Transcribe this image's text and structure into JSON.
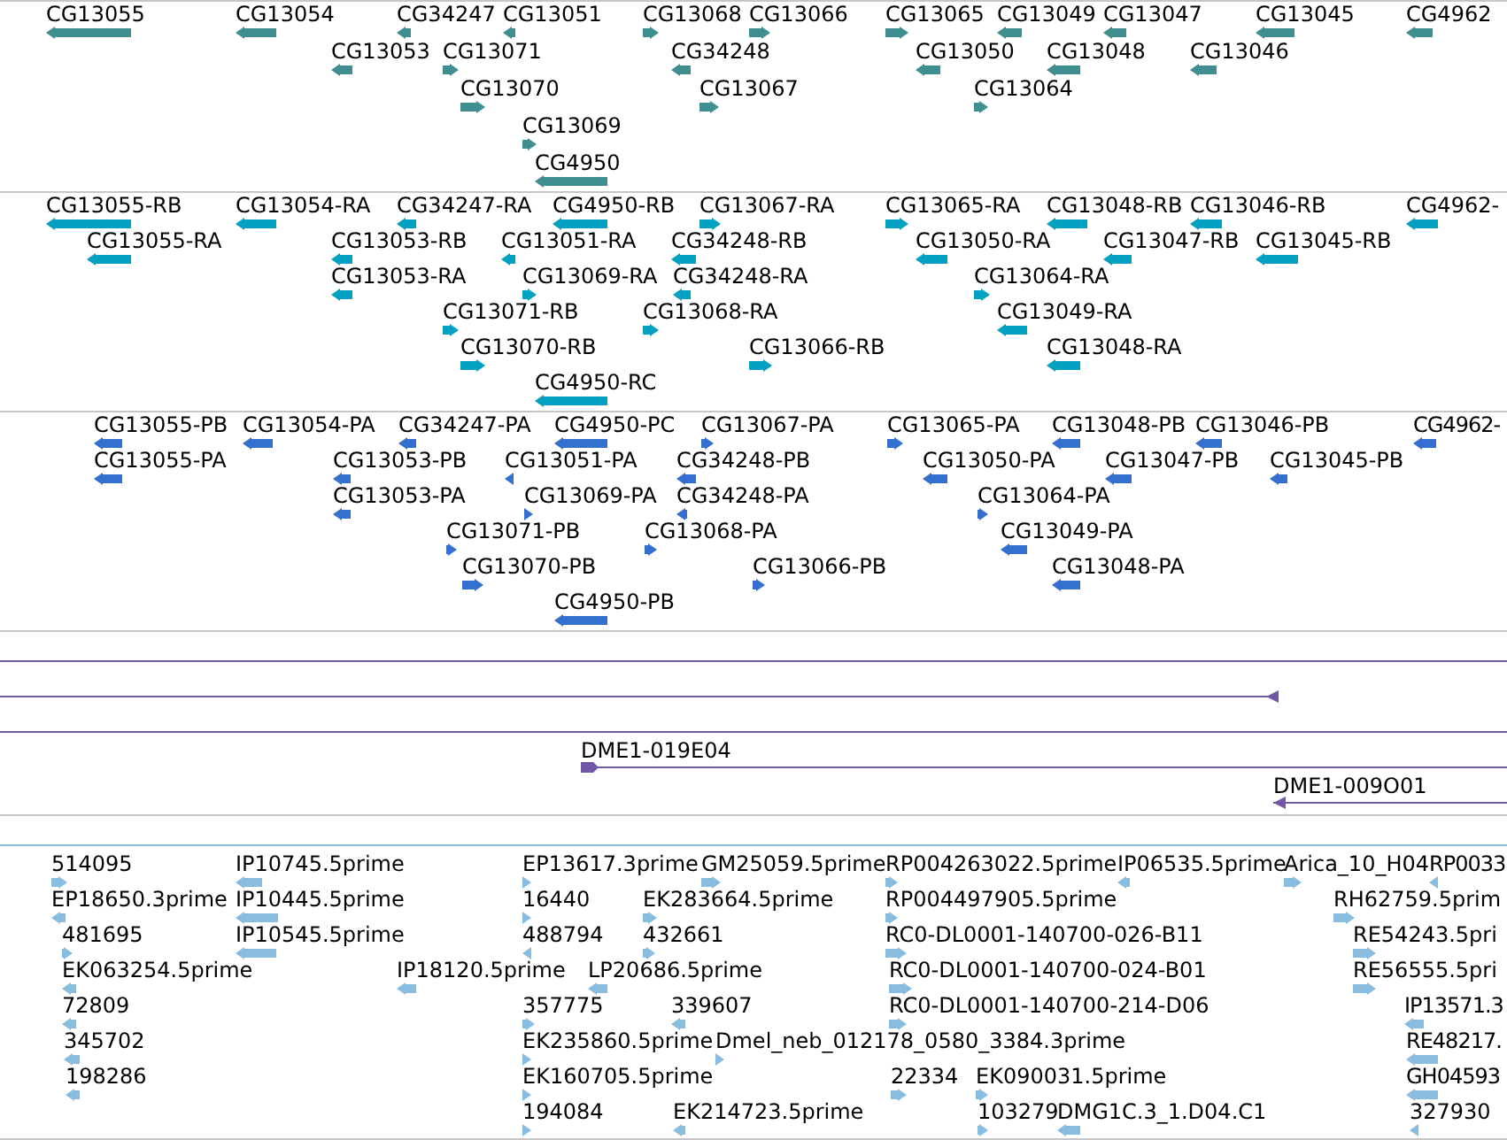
{
  "tracks": [
    {
      "kind": "gene",
      "rows": [
        {
          "kind": "features",
          "features": [
            {
              "label": "CG13055",
              "reverse": true
            },
            {
              "label": "CG13054",
              "reverse": true
            },
            {
              "label": "CG34247",
              "reverse": true
            },
            {
              "label": "CG13051",
              "reverse": true
            },
            {
              "label": "CG13068",
              "reverse": false
            },
            {
              "label": "CG13066",
              "reverse": false
            },
            {
              "label": "CG13065",
              "reverse": false
            },
            {
              "label": "CG13049",
              "reverse": true
            },
            {
              "label": "CG13047",
              "reverse": true
            },
            {
              "label": "CG13045",
              "reverse": true
            },
            {
              "label": "CG4962",
              "reverse": true
            }
          ]
        },
        {
          "kind": "features",
          "features": [
            {
              "label": "CG13053",
              "reverse": true
            },
            {
              "label": "CG13071",
              "reverse": false
            },
            {
              "label": "CG34248",
              "reverse": true
            },
            {
              "label": "CG13050",
              "reverse": true
            },
            {
              "label": "CG13048",
              "reverse": true
            },
            {
              "label": "CG13046",
              "reverse": true
            }
          ]
        },
        {
          "kind": "features",
          "features": [
            {
              "label": "CG13070",
              "reverse": false
            },
            {
              "label": "CG13067",
              "reverse": false
            },
            {
              "label": "CG13064",
              "reverse": false
            }
          ]
        },
        {
          "kind": "features",
          "features": [
            {
              "label": "CG13069",
              "reverse": false
            }
          ]
        },
        {
          "kind": "features",
          "features": [
            {
              "label": "CG4950",
              "reverse": true
            }
          ]
        }
      ]
    },
    {
      "kind": "transcript",
      "rows": [
        {
          "kind": "features",
          "features": [
            {
              "label": "CG13055-RB",
              "reverse": true
            },
            {
              "label": "CG13054-RA",
              "reverse": true
            },
            {
              "label": "CG34247-RA",
              "reverse": true
            },
            {
              "label": "CG4950-RB",
              "reverse": true
            },
            {
              "label": "CG13067-RA",
              "reverse": false
            },
            {
              "label": "CG13065-RA",
              "reverse": false
            },
            {
              "label": "CG13048-RB",
              "reverse": true
            },
            {
              "label": "CG13046-RB",
              "reverse": true
            },
            {
              "label": "CG4962-",
              "reverse": true
            }
          ]
        },
        {
          "kind": "features",
          "features": [
            {
              "label": "CG13055-RA",
              "reverse": true
            },
            {
              "label": "CG13053-RB",
              "reverse": true
            },
            {
              "label": "CG13051-RA",
              "reverse": true
            },
            {
              "label": "CG34248-RB",
              "reverse": true
            },
            {
              "label": "CG13050-RA",
              "reverse": true
            },
            {
              "label": "CG13047-RB",
              "reverse": true
            },
            {
              "label": "CG13045-RB",
              "reverse": true
            }
          ]
        },
        {
          "kind": "features",
          "features": [
            {
              "label": "CG13053-RA",
              "reverse": true
            },
            {
              "label": "CG13069-RA",
              "reverse": false
            },
            {
              "label": "CG34248-RA",
              "reverse": true
            },
            {
              "label": "CG13064-RA",
              "reverse": false
            }
          ]
        },
        {
          "kind": "features",
          "features": [
            {
              "label": "CG13071-RB",
              "reverse": false
            },
            {
              "label": "CG13068-RA",
              "reverse": false
            },
            {
              "label": "CG13049-RA",
              "reverse": true
            }
          ]
        },
        {
          "kind": "features",
          "features": [
            {
              "label": "CG13070-RB",
              "reverse": false
            },
            {
              "label": "CG13066-RB",
              "reverse": false
            },
            {
              "label": "CG13048-RA",
              "reverse": true
            }
          ]
        },
        {
          "kind": "features",
          "features": [
            {
              "label": "CG4950-RC",
              "reverse": true
            }
          ]
        }
      ]
    },
    {
      "kind": "protein",
      "rows": [
        {
          "kind": "features",
          "features": [
            {
              "label": "CG13055-PB",
              "reverse": true
            },
            {
              "label": "CG13054-PA",
              "reverse": true
            },
            {
              "label": "CG34247-PA",
              "reverse": true
            },
            {
              "label": "CG4950-PC",
              "reverse": true
            },
            {
              "label": "CG13067-PA",
              "reverse": false
            },
            {
              "label": "CG13065-PA",
              "reverse": false
            },
            {
              "label": "CG13048-PB",
              "reverse": true
            },
            {
              "label": "CG13046-PB",
              "reverse": true
            },
            {
              "label": "CG4962-",
              "reverse": true
            }
          ]
        },
        {
          "kind": "features",
          "features": [
            {
              "label": "CG13055-PA",
              "reverse": true
            },
            {
              "label": "CG13053-PB",
              "reverse": true
            },
            {
              "label": "CG13051-PA",
              "reverse": true
            },
            {
              "label": "CG34248-PB",
              "reverse": true
            },
            {
              "label": "CG13050-PA",
              "reverse": true
            },
            {
              "label": "CG13047-PB",
              "reverse": true
            },
            {
              "label": "CG13045-PB",
              "reverse": true
            }
          ]
        },
        {
          "kind": "features",
          "features": [
            {
              "label": "CG13053-PA",
              "reverse": true
            },
            {
              "label": "CG13069-PA",
              "reverse": false
            },
            {
              "label": "CG34248-PA",
              "reverse": true
            },
            {
              "label": "CG13064-PA",
              "reverse": false
            }
          ]
        },
        {
          "kind": "features",
          "features": [
            {
              "label": "CG13071-PB",
              "reverse": false
            },
            {
              "label": "CG13068-PA",
              "reverse": false
            },
            {
              "label": "CG13049-PA",
              "reverse": true
            }
          ]
        },
        {
          "kind": "features",
          "features": [
            {
              "label": "CG13070-PB",
              "reverse": false
            },
            {
              "label": "CG13066-PB",
              "reverse": false
            },
            {
              "label": "CG13048-PA",
              "reverse": true
            }
          ]
        },
        {
          "kind": "features",
          "features": [
            {
              "label": "CG4950-PB",
              "reverse": true
            }
          ]
        }
      ]
    },
    {
      "kind": "clone",
      "rows": [
        {
          "kind": "line"
        },
        {
          "kind": "features",
          "features": [
            {
              "reverse": true
            }
          ]
        },
        {
          "kind": "line"
        },
        {
          "kind": "features",
          "features": [
            {
              "label": "DME1-019E04",
              "reverse": false
            }
          ]
        },
        {
          "kind": "features",
          "features": [
            {
              "label": "DME1-009O01",
              "reverse": true
            }
          ]
        }
      ]
    },
    {
      "kind": "est",
      "rows": [
        {
          "kind": "line"
        },
        {
          "kind": "features",
          "features": [
            {
              "label": "514095",
              "reverse": false
            },
            {
              "label": "IP10745.5prime",
              "reverse": true
            },
            {
              "label": "EP13617.3prime",
              "reverse": false
            },
            {
              "label": "GM25059.5prime",
              "reverse": false
            },
            {
              "label": "RP004263022.5prime",
              "reverse": false
            },
            {
              "label": "IP06535.5prime",
              "reverse": true
            },
            {
              "label": "Arica_10_H04",
              "reverse": false
            },
            {
              "label": "RP0033",
              "reverse": true
            }
          ]
        },
        {
          "kind": "features",
          "features": [
            {
              "label": "EP18650.3prime",
              "reverse": true
            },
            {
              "label": "IP10445.5prime",
              "reverse": true
            },
            {
              "label": "16440",
              "reverse": false
            },
            {
              "label": "EK283664.5prime",
              "reverse": false
            },
            {
              "label": "RP004497905.5prime",
              "reverse": false
            },
            {
              "label": "RH62759.5prim",
              "reverse": false
            }
          ]
        },
        {
          "kind": "features",
          "features": [
            {
              "label": "481695",
              "reverse": false
            },
            {
              "label": "IP10545.5prime",
              "reverse": true
            },
            {
              "label": "488794",
              "reverse": true
            },
            {
              "label": "432661",
              "reverse": false
            },
            {
              "label": "RC0-DL0001-140700-026-B11",
              "reverse": false
            },
            {
              "label": "RE54243.5pri",
              "reverse": false
            }
          ]
        },
        {
          "kind": "features",
          "features": [
            {
              "label": "EK063254.5prime",
              "reverse": true
            },
            {
              "label": "IP18120.5prime",
              "reverse": true
            },
            {
              "label": "LP20686.5prime",
              "reverse": true
            },
            {
              "label": "RC0-DL0001-140700-024-B01",
              "reverse": false
            },
            {
              "label": "RE56555.5pri",
              "reverse": false
            }
          ]
        },
        {
          "kind": "features",
          "features": [
            {
              "label": "72809",
              "reverse": true
            },
            {
              "label": "357775",
              "reverse": false
            },
            {
              "label": "339607",
              "reverse": true
            },
            {
              "label": "RC0-DL0001-140700-214-D06",
              "reverse": false
            },
            {
              "label": "IP13571.3",
              "reverse": true
            }
          ]
        },
        {
          "kind": "features",
          "features": [
            {
              "label": "345702",
              "reverse": true
            },
            {
              "label": "EK235860.5prime",
              "reverse": false
            },
            {
              "label": "Dmel_neb_012178_0580_3384.3prime",
              "reverse": false
            },
            {
              "label": "RE48217.",
              "reverse": true
            }
          ]
        },
        {
          "kind": "features",
          "features": [
            {
              "label": "198286",
              "reverse": true
            },
            {
              "label": "EK160705.5prime",
              "reverse": false
            },
            {
              "label": "22334",
              "reverse": false
            },
            {
              "label": "EK090031.5prime",
              "reverse": false
            },
            {
              "label": "GH04593",
              "reverse": true
            }
          ]
        },
        {
          "kind": "features",
          "features": [
            {
              "label": "194084",
              "reverse": false
            },
            {
              "label": "EK214723.5prime",
              "reverse": true
            },
            {
              "label": "103279",
              "reverse": false
            },
            {
              "label": "DMG1C.3_1.D04.C1",
              "reverse": true
            },
            {
              "label": "327930",
              "reverse": true
            }
          ]
        }
      ]
    }
  ]
}
